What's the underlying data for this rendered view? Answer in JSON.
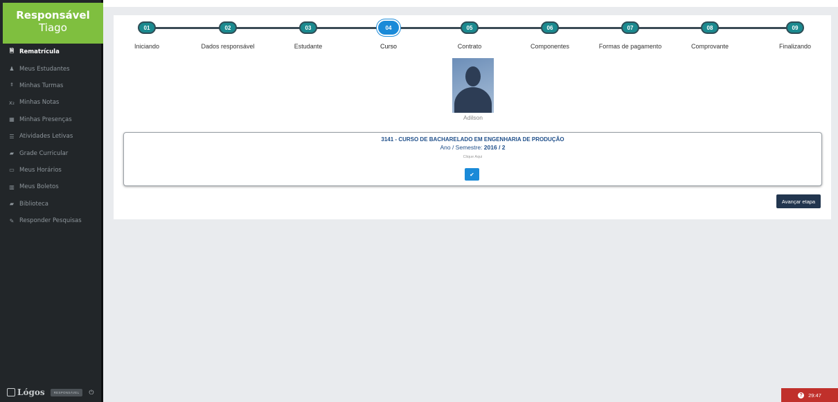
{
  "sidebar": {
    "brand_title": "Responsável",
    "brand_user": "Tiago",
    "items": [
      {
        "label": "Rematrícula",
        "icon": "file-icon",
        "glyph": "🗎"
      },
      {
        "label": "Meus Estudantes",
        "icon": "user-icon",
        "glyph": "♟"
      },
      {
        "label": "Minhas Turmas",
        "icon": "pin-icon",
        "glyph": "⯒"
      },
      {
        "label": "Minhas Notas",
        "icon": "subscript-icon",
        "glyph": "x₂"
      },
      {
        "label": "Minhas Presenças",
        "icon": "table-icon",
        "glyph": "▦"
      },
      {
        "label": "Atividades Letivas",
        "icon": "list-icon",
        "glyph": "☰"
      },
      {
        "label": "Grade Curricular",
        "icon": "book-icon",
        "glyph": "▰"
      },
      {
        "label": "Meus Horários",
        "icon": "calendar-icon",
        "glyph": "▭"
      },
      {
        "label": "Meus Boletos",
        "icon": "barcode-icon",
        "glyph": "▥"
      },
      {
        "label": "Biblioteca",
        "icon": "book-icon",
        "glyph": "▰"
      },
      {
        "label": "Responder Pesquisas",
        "icon": "edit-icon",
        "glyph": "✎"
      }
    ],
    "footer": {
      "logo": "Lógos",
      "role": "RESPONSÁVEL",
      "power_icon": "power-icon",
      "power_glyph": "⏻"
    }
  },
  "steps": [
    {
      "number": "01",
      "label": "Iniciando"
    },
    {
      "number": "02",
      "label": "Dados responsável"
    },
    {
      "number": "03",
      "label": "Estudante"
    },
    {
      "number": "04",
      "label": "Curso"
    },
    {
      "number": "05",
      "label": "Contrato"
    },
    {
      "number": "06",
      "label": "Componentes"
    },
    {
      "number": "07",
      "label": "Formas de pagamento"
    },
    {
      "number": "08",
      "label": "Comprovante"
    },
    {
      "number": "09",
      "label": "Finalizando"
    }
  ],
  "current_step": "04",
  "student": {
    "name": "Adilson"
  },
  "course": {
    "title": "3141 - CURSO DE BACHARELADO EM ENGENHARIA DE PRODUÇÃO",
    "year_label": "Ano / Semestre:",
    "year_value": "2016 / 2",
    "hint": "Clique Aqui",
    "check_glyph": "✔"
  },
  "actions": {
    "advance": "Avançar etapa"
  },
  "timer": {
    "value": "29:47",
    "icon": "question-icon",
    "glyph": "?"
  },
  "colors": {
    "brand": "#7fbf3f",
    "step": "#1b8a8f",
    "current_step": "#1a8ad8",
    "timer": "#c0302b"
  }
}
